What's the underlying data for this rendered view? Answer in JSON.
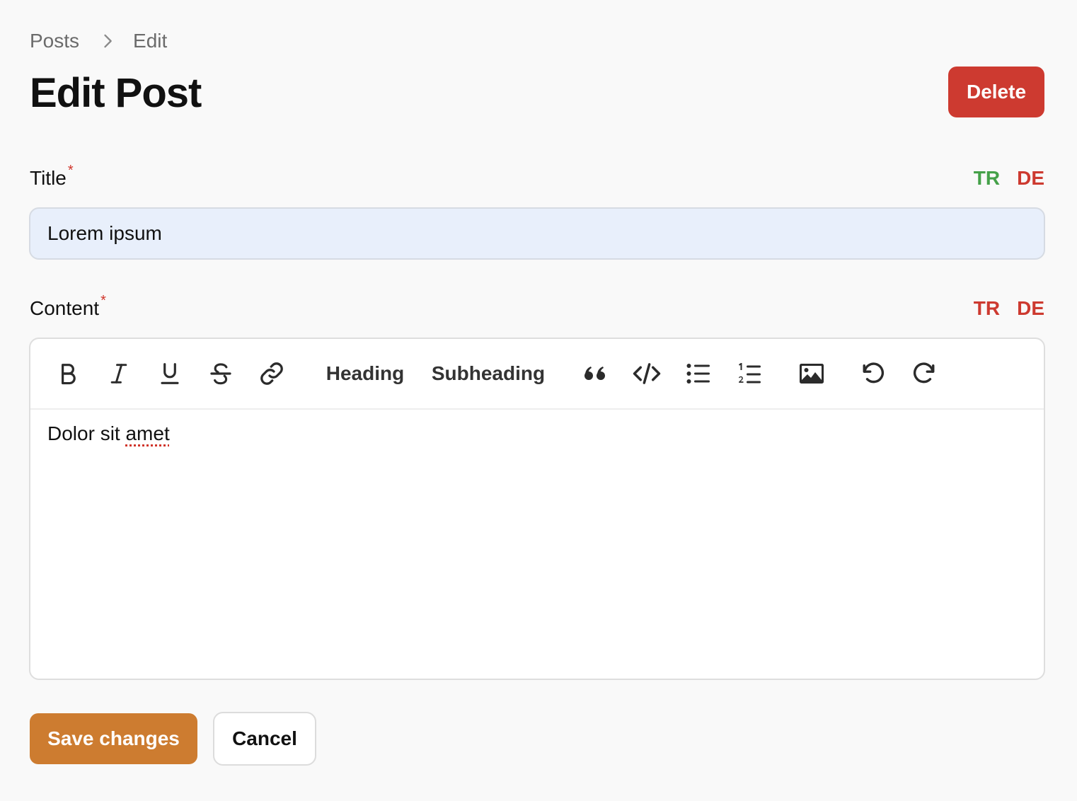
{
  "breadcrumb": {
    "items": [
      "Posts",
      "Edit"
    ]
  },
  "page": {
    "title": "Edit Post"
  },
  "actions": {
    "delete_label": "Delete",
    "save_label": "Save changes",
    "cancel_label": "Cancel"
  },
  "fields": {
    "title": {
      "label": "Title",
      "required_mark": "*",
      "value": "Lorem ipsum",
      "languages": [
        {
          "code": "TR",
          "status": "translated",
          "color": "#45a149"
        },
        {
          "code": "DE",
          "status": "missing",
          "color": "#cd3a30"
        }
      ]
    },
    "content": {
      "label": "Content",
      "required_mark": "*",
      "body_text_plain": "Dolor sit ",
      "body_text_misspelled": "amet",
      "languages": [
        {
          "code": "TR",
          "status": "missing",
          "color": "#cd3a30"
        },
        {
          "code": "DE",
          "status": "missing",
          "color": "#cd3a30"
        }
      ]
    }
  },
  "toolbar": {
    "heading_label": "Heading",
    "subheading_label": "Subheading",
    "icons": [
      "bold-icon",
      "italic-icon",
      "underline-icon",
      "strikethrough-icon",
      "link-icon",
      "quote-icon",
      "code-icon",
      "bullet-list-icon",
      "numbered-list-icon",
      "image-icon",
      "undo-icon",
      "redo-icon"
    ]
  },
  "colors": {
    "background": "#f9f9f9",
    "danger": "#cd3a30",
    "primary": "#cd7c30",
    "success": "#45a149",
    "input_fill": "#e8effb"
  }
}
